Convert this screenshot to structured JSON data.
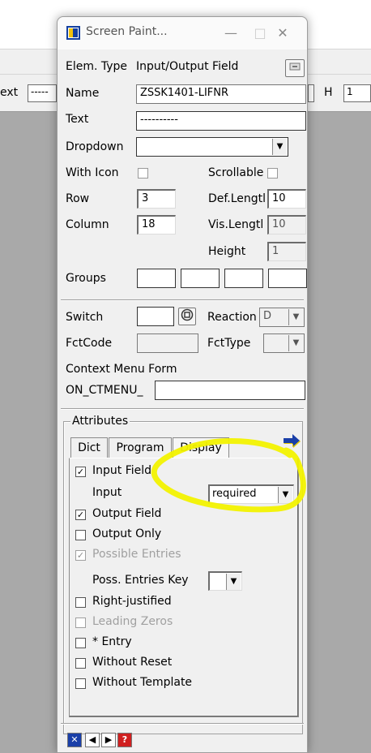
{
  "background": {
    "left_label": "ext",
    "left_field": "-----",
    "right_label": "H",
    "right_field": "1"
  },
  "window": {
    "title": "Screen Paint...",
    "minimize_glyph": "—",
    "maximize_glyph": "□",
    "close_glyph": "✕"
  },
  "form": {
    "elem_type_label": "Elem. Type",
    "elem_type_value": "Input/Output Field",
    "name_label": "Name",
    "name_value": "ZSSK1401-LIFNR",
    "text_label": "Text",
    "text_value": "----------",
    "dropdown_label": "Dropdown",
    "dropdown_value": "",
    "with_icon_label": "With Icon",
    "scrollable_label": "Scrollable",
    "row_label": "Row",
    "row_value": "3",
    "def_length_label": "Def.Lengtl",
    "def_length_value": "10",
    "column_label": "Column",
    "column_value": "18",
    "vis_length_label": "Vis.Lengtl",
    "vis_length_value": "10",
    "height_label": "Height",
    "height_value": "1",
    "groups_label": "Groups",
    "switch_label": "Switch",
    "reaction_label": "Reaction",
    "reaction_value": "D",
    "fctcode_label": "FctCode",
    "fcttype_label": "FctType",
    "context_menu_label": "Context Menu Form",
    "on_ctmenu_label": "ON_CTMENU_"
  },
  "attributes": {
    "group_title": "Attributes",
    "tabs": [
      "Dict",
      "Program",
      "Display"
    ],
    "input_field_label": "Input Field",
    "input_field_checked": true,
    "input_label": "Input",
    "input_value": "required",
    "output_field_label": "Output Field",
    "output_field_checked": true,
    "output_only_label": "Output Only",
    "possible_entries_label": "Possible Entries",
    "poss_entries_key_label": "Poss. Entries Key",
    "right_justified_label": "Right-justified",
    "leading_zeros_label": "Leading Zeros",
    "star_entry_label": "* Entry",
    "without_reset_label": "Without Reset",
    "without_template_label": "Without Template"
  },
  "colors": {
    "highlight": "#f2f200",
    "accent_blue": "#1440a0",
    "help_red": "#d02020"
  }
}
